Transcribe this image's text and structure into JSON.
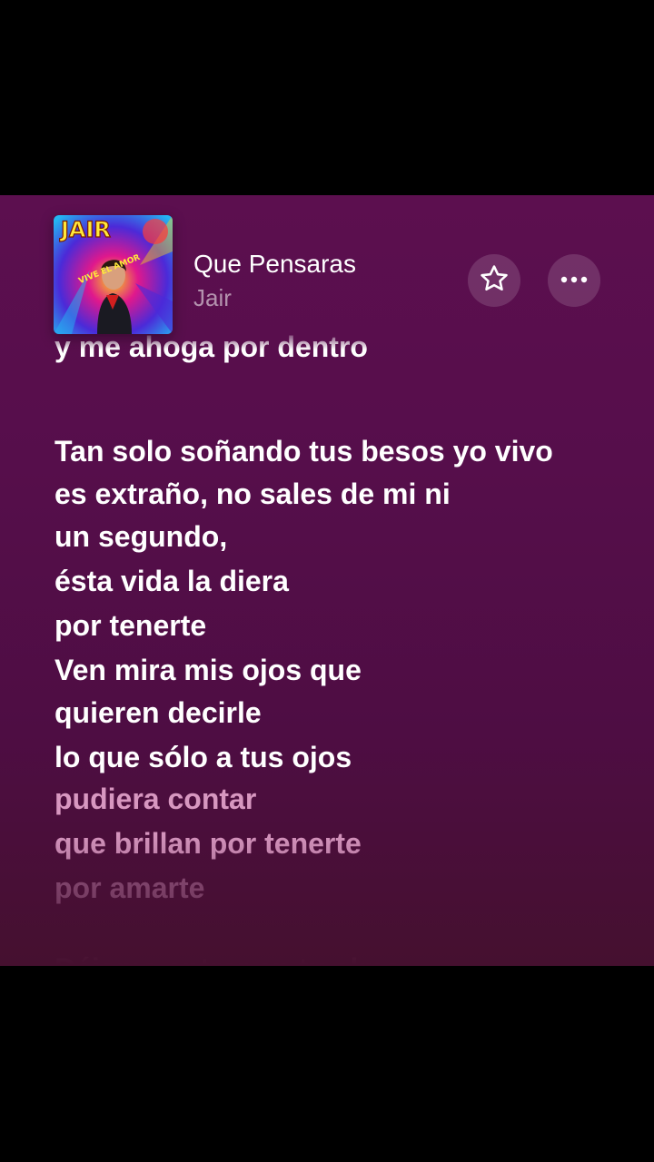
{
  "now_playing": {
    "title": "Que Pensaras",
    "artist": "Jair",
    "album_art": {
      "text_top": "JAIR",
      "text_arc": "VIVE EL AMOR",
      "colors": [
        "#e0188c",
        "#4b2ad8",
        "#f7d21a",
        "#23b6f2"
      ]
    }
  },
  "controls": {
    "favorite_icon": "star-outline-icon",
    "more_icon": "ellipsis-icon"
  },
  "lyrics": {
    "lines": [
      "y me ahoga por dentro",
      "",
      "Tan solo soñando tus besos yo vivo",
      "es extraño, no sales de mi ni",
      "un segundo,",
      "ésta vida la diera",
      "por tenerte",
      "Ven mira mis ojos que",
      "quieren decirle",
      "lo que sólo a tus ojos",
      "pudiera contar",
      "que brillan por tenerte",
      "por amarte",
      "",
      "Déjame entrar en tu alma"
    ]
  },
  "theme": {
    "background": "#560e4b",
    "text_active": "#ffffff",
    "text_upcoming": "#f5b8e0"
  }
}
